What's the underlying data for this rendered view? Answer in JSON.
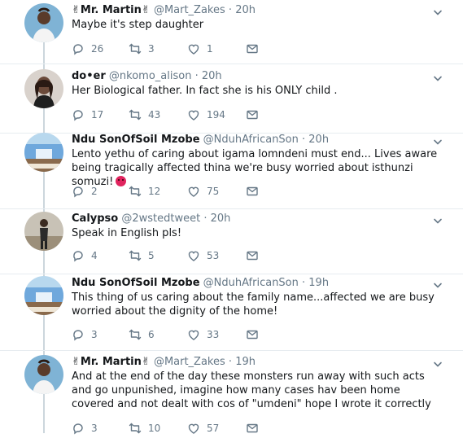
{
  "tweets": [
    {
      "name": "✌Mr. Martin✌",
      "handle": "@Mart_Zakes",
      "time": "20h",
      "text": "Maybe it's step daughter",
      "replies": "26",
      "retweets": "3",
      "likes": "1",
      "avatar_bg": "#7fb3d5"
    },
    {
      "name": "do•er",
      "handle": "@nkomo_alison",
      "time": "20h",
      "text": "Her Biological father.  In fact she is his ONLY child .",
      "replies": "17",
      "retweets": "43",
      "likes": "194",
      "avatar_bg": "#d9d2cc"
    },
    {
      "name": "Ndu SonOfSoil Mzobe",
      "handle": "@NduhAfricanSon",
      "time": "20h",
      "text": "Lento yethu of caring about igama lomndeni must end... Lives aware being tragically affected thina we're busy worried about isthunzi somuzi!",
      "replies": "2",
      "retweets": "12",
      "likes": "75",
      "avatar_bg": "#6fa8dc"
    },
    {
      "name": "Calypso",
      "handle": "@2wstedtweet",
      "time": "20h",
      "text": "Speak in English pls!",
      "replies": "4",
      "retweets": "5",
      "likes": "53",
      "avatar_bg": "#c8c2b6"
    },
    {
      "name": "Ndu SonOfSoil Mzobe",
      "handle": "@NduhAfricanSon",
      "time": "19h",
      "text": "This thing of us caring about the family name...affected we are busy worried about the dignity of the home!",
      "replies": "3",
      "retweets": "6",
      "likes": "33",
      "avatar_bg": "#6fa8dc"
    },
    {
      "name": "✌Mr. Martin✌",
      "handle": "@Mart_Zakes",
      "time": "19h",
      "text": "And at the end of the day these monsters run away with such acts and go unpunished, imagine how many cases hav been home covered and not dealt with cos of \"umdeni\" hope I wrote it correctly",
      "replies": "3",
      "retweets": "10",
      "likes": "57",
      "avatar_bg": "#7fb3d5"
    }
  ],
  "colors": {
    "text_primary": "#14171a",
    "text_secondary": "#657786",
    "thread_line": "#ccd6dd"
  }
}
